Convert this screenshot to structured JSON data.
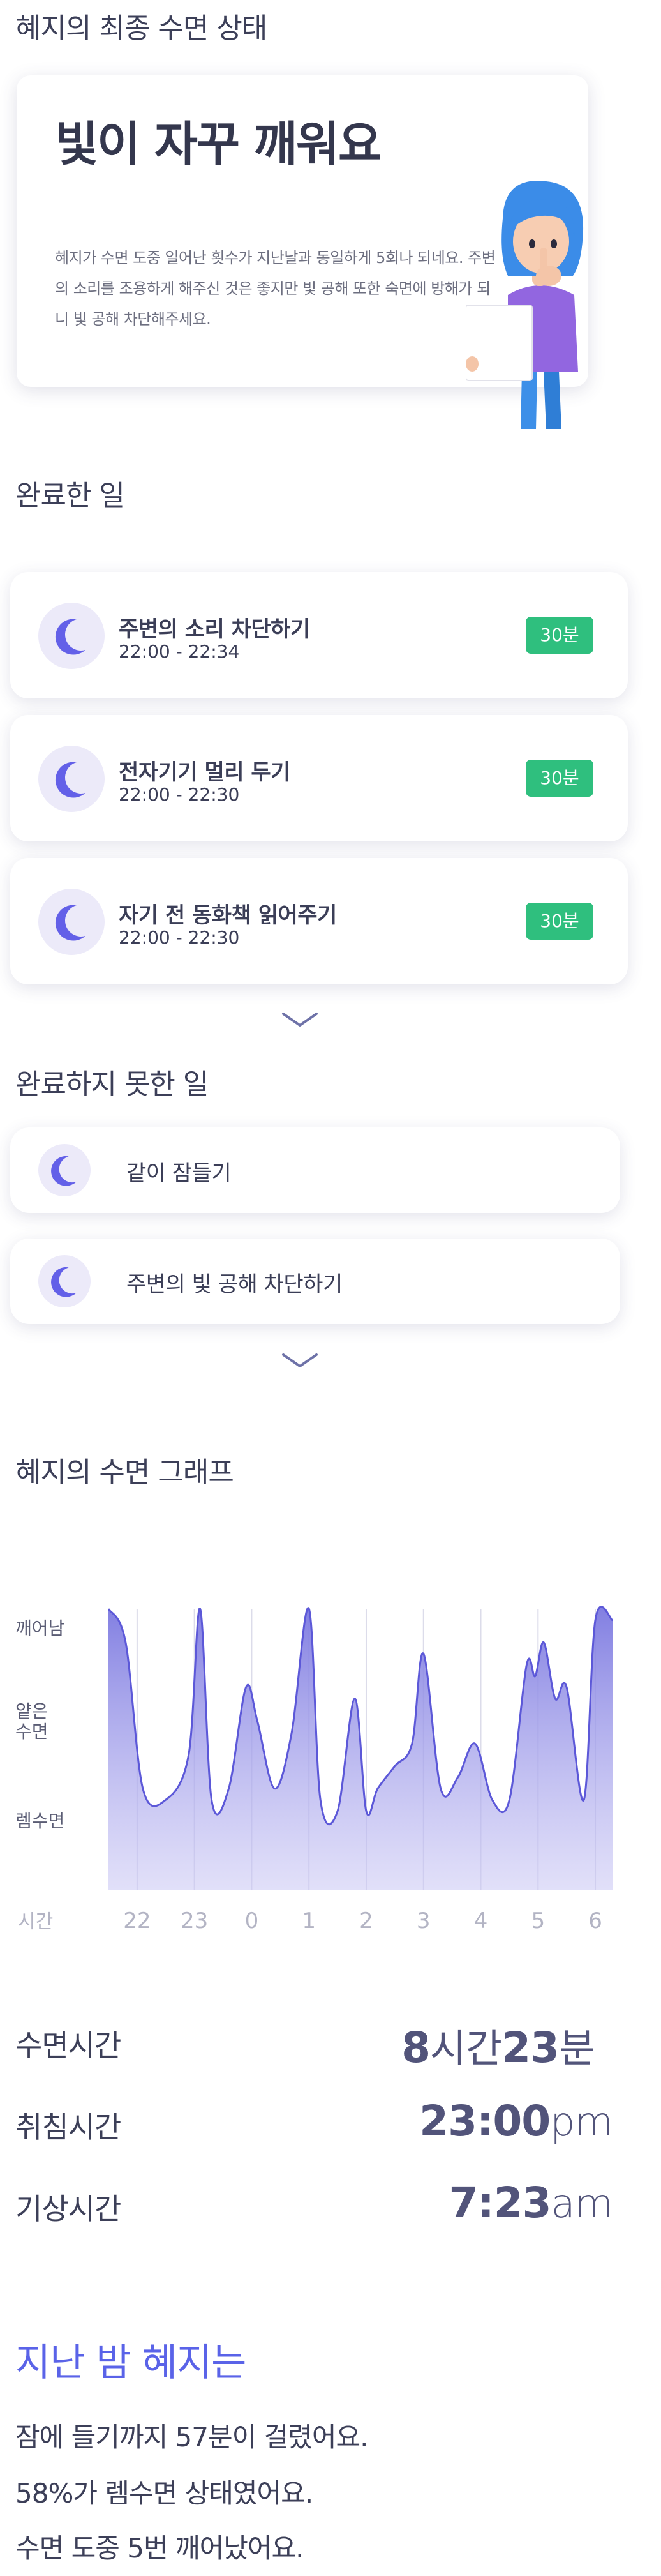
{
  "status": {
    "section_title": "혜지의 최종 수면 상태",
    "headline": "빛이 자꾸 깨워요",
    "description": "혜지가 수면 도중 일어난 횟수가 지난날과 동일하게 5회나 되네요. 주변의 소리를 조용하게 해주신 것은 좋지만 빛 공해 또한 숙면에 방해가 되니 빛 공해 차단해주세요."
  },
  "done": {
    "section_title": "완료한 일",
    "items": [
      {
        "title": "주변의 소리 차단하기",
        "time": "22:00 - 22:34",
        "badge": "30분"
      },
      {
        "title": "전자기기 멀리 두기",
        "time": "22:00 - 22:30",
        "badge": "30분"
      },
      {
        "title": "자기 전 동화책 읽어주기",
        "time": "22:00 - 22:30",
        "badge": "30분"
      }
    ]
  },
  "undone": {
    "section_title": "완료하지 못한 일",
    "items": [
      {
        "label": "같이 잠들기"
      },
      {
        "label": "주변의 빛 공해 차단하기"
      }
    ]
  },
  "graph": {
    "section_title": "혜지의 수면 그래프",
    "y_levels": [
      "깨어남",
      "얕은 수면",
      "렘수면"
    ],
    "x_axis_label": "시간",
    "x_ticks": [
      "22",
      "23",
      "0",
      "1",
      "2",
      "3",
      "4",
      "5",
      "6"
    ],
    "fill_color": "#7b78e0",
    "line_color": "#5c58d8"
  },
  "chart_data": {
    "type": "area",
    "ylabel_levels": [
      "렘수면",
      "얕은 수면",
      "깨어남"
    ],
    "xlabel": "시간",
    "x_ticks": [
      "22",
      "23",
      "0",
      "1",
      "2",
      "3",
      "4",
      "5",
      "6"
    ],
    "x": [
      21.5,
      21.8,
      22.1,
      22.5,
      22.9,
      23.1,
      23.3,
      23.6,
      23.9,
      24.1,
      24.4,
      24.7,
      25.0,
      25.2,
      25.5,
      25.8,
      26.0,
      26.2,
      26.5,
      26.8,
      27.0,
      27.3,
      27.6,
      27.9,
      28.2,
      28.5,
      28.8,
      28.95,
      29.1,
      29.3,
      29.5,
      29.8,
      30.0,
      30.3
    ],
    "y": [
      3.0,
      2.7,
      1.4,
      1.3,
      1.7,
      3.0,
      1.3,
      1.4,
      2.3,
      2.0,
      1.4,
      1.9,
      3.0,
      1.3,
      1.2,
      2.2,
      1.2,
      1.4,
      1.6,
      1.8,
      2.6,
      1.4,
      1.5,
      1.8,
      1.3,
      1.3,
      2.5,
      2.4,
      2.7,
      2.2,
      2.3,
      1.3,
      2.9,
      2.9
    ],
    "y_level_values": {
      "깨어남": 3,
      "얕은 수면": 2,
      "렘수면": 1
    }
  },
  "stats": {
    "sleep_time": {
      "label": "수면시간",
      "hours": "8",
      "hours_unit": "시간",
      "minutes": "23",
      "minutes_unit": "분"
    },
    "bed_time": {
      "label": "취침시간",
      "value": "23:00",
      "suffix": "pm"
    },
    "wake_time": {
      "label": "기상시간",
      "value": "7:23",
      "suffix": "am"
    }
  },
  "summary": {
    "title": "지난 밤 혜지는",
    "lines": [
      "잠에 들기까지 57분이 걸렸어요.",
      "58%가 렘수면 상태였어요.",
      "수면 도중 5번 깨어났어요."
    ]
  },
  "colors": {
    "accent": "#5a63e8",
    "badge_green": "#2fbf7e",
    "moon": "#6360e8",
    "moon_bg": "#eceaf9"
  }
}
